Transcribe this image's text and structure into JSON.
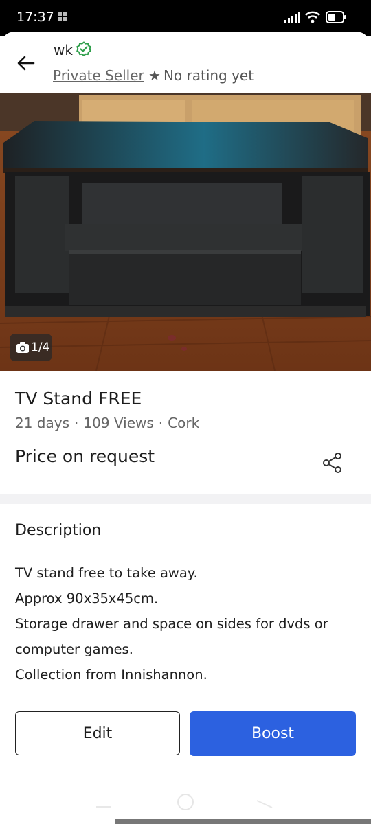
{
  "status_bar": {
    "time": "17:37"
  },
  "seller": {
    "name": "wk",
    "type": "Private Seller",
    "rating": "No rating yet"
  },
  "photo": {
    "counter": "1/4"
  },
  "listing": {
    "title": "TV Stand FREE",
    "age": "21 days",
    "views": "109 Views",
    "location": "Cork",
    "price": "Price on request"
  },
  "description": {
    "heading": "Description",
    "lines": [
      "TV stand free to take away.",
      "Approx 90x35x45cm.",
      "Storage drawer and space on sides for dvds or",
      "computer games.",
      "Collection from Innishannon."
    ]
  },
  "actions": {
    "edit_label": "Edit",
    "boost_label": "Boost"
  },
  "icons": {
    "back": "arrow-left-icon",
    "verified": "verified-check-icon",
    "star": "star-icon",
    "camera": "camera-icon",
    "share": "share-icon"
  },
  "colors": {
    "boost": "#2c61e0",
    "verified": "#2e9e4a"
  }
}
